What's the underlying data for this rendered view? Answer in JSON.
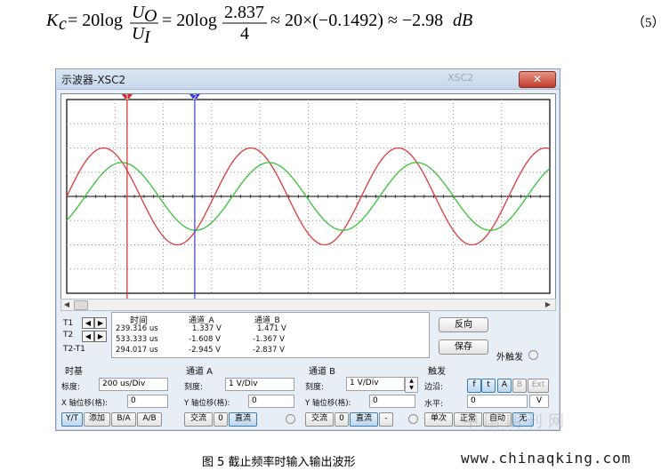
{
  "equation": {
    "lhs": "K",
    "lhs_sub": "c",
    "eq1": "= 20log",
    "frac1_num": "U",
    "frac1_num_sub": "O",
    "frac1_den": "U",
    "frac1_den_sub": "I",
    "eq2": "= 20log",
    "frac2_num": "2.837",
    "frac2_den": "4",
    "rest": "≈ 20×(−0.1492) ≈ −2.98",
    "unit": "dB",
    "number": "（5）"
  },
  "window": {
    "title": "示波器-XSC2",
    "ghost_title": "XSC2",
    "close_label": "✕"
  },
  "cursors": {
    "t1_marker": "1",
    "t2_marker": "2"
  },
  "measure": {
    "row_labels": [
      "T1",
      "T2",
      "T2-T1"
    ],
    "headers": {
      "time": "时间",
      "channel_a": "通道_A",
      "channel_b": "通道_B"
    },
    "rows": [
      {
        "time": "239.316 us",
        "a": "1.337 V",
        "b": "1.471 V"
      },
      {
        "time": "533.333 us",
        "a": "-1.608 V",
        "b": "-1.367 V"
      },
      {
        "time": "294.017 us",
        "a": "-2.945 V",
        "b": "-2.837 V"
      }
    ],
    "reverse_label": "反向",
    "save_label": "保存",
    "ext_trigger_label": "外触发"
  },
  "timebase": {
    "title": "时基",
    "scale_label": "标度:",
    "scale_value": "200 us/Div",
    "xpos_label": "X 轴位移(格):",
    "xpos_value": "0",
    "buttons": [
      "Y/T",
      "添加",
      "B/A",
      "A/B"
    ]
  },
  "channel_a": {
    "title": "通道 A",
    "scale_label": "刻度:",
    "scale_value": "1  V/Div",
    "ypos_label": "Y 轴位移(格):",
    "ypos_value": "0",
    "buttons": [
      "交流",
      "0",
      "直流"
    ]
  },
  "channel_b": {
    "title": "通道 B",
    "scale_label": "刻度:",
    "scale_value": "1  V/Div",
    "ypos_label": "Y 轴位移(格):",
    "ypos_value": "0",
    "buttons": [
      "交流",
      "0",
      "直流",
      "-"
    ]
  },
  "trigger": {
    "title": "触发",
    "edge_label": "边沿:",
    "edge_buttons": [
      "f",
      "t",
      "A",
      "B",
      "Ext"
    ],
    "level_label": "水平:",
    "level_value": "0",
    "level_unit": "V",
    "mode_buttons": [
      "单次",
      "正常",
      "自动",
      "无"
    ]
  },
  "caption": "图 5  截止频率时输入输出波形",
  "watermark": {
    "url": "www.chinaqking.com",
    "cn": "中国期刊网"
  },
  "colors": {
    "trace_a": "#e03a3a",
    "trace_b": "#35c435",
    "cursor1": "#d62b2b",
    "cursor2": "#3a3adf"
  },
  "chart_data": {
    "type": "line",
    "series": [
      {
        "color": "#e03a3a",
        "amplitude": 2.0,
        "phase_note": "input"
      },
      {
        "color": "#35c435",
        "amplitude": 1.4,
        "phase_note": "output"
      }
    ],
    "xlim_div": [
      0,
      10
    ],
    "ylim_div": [
      -4,
      4
    ],
    "grid": true
  }
}
